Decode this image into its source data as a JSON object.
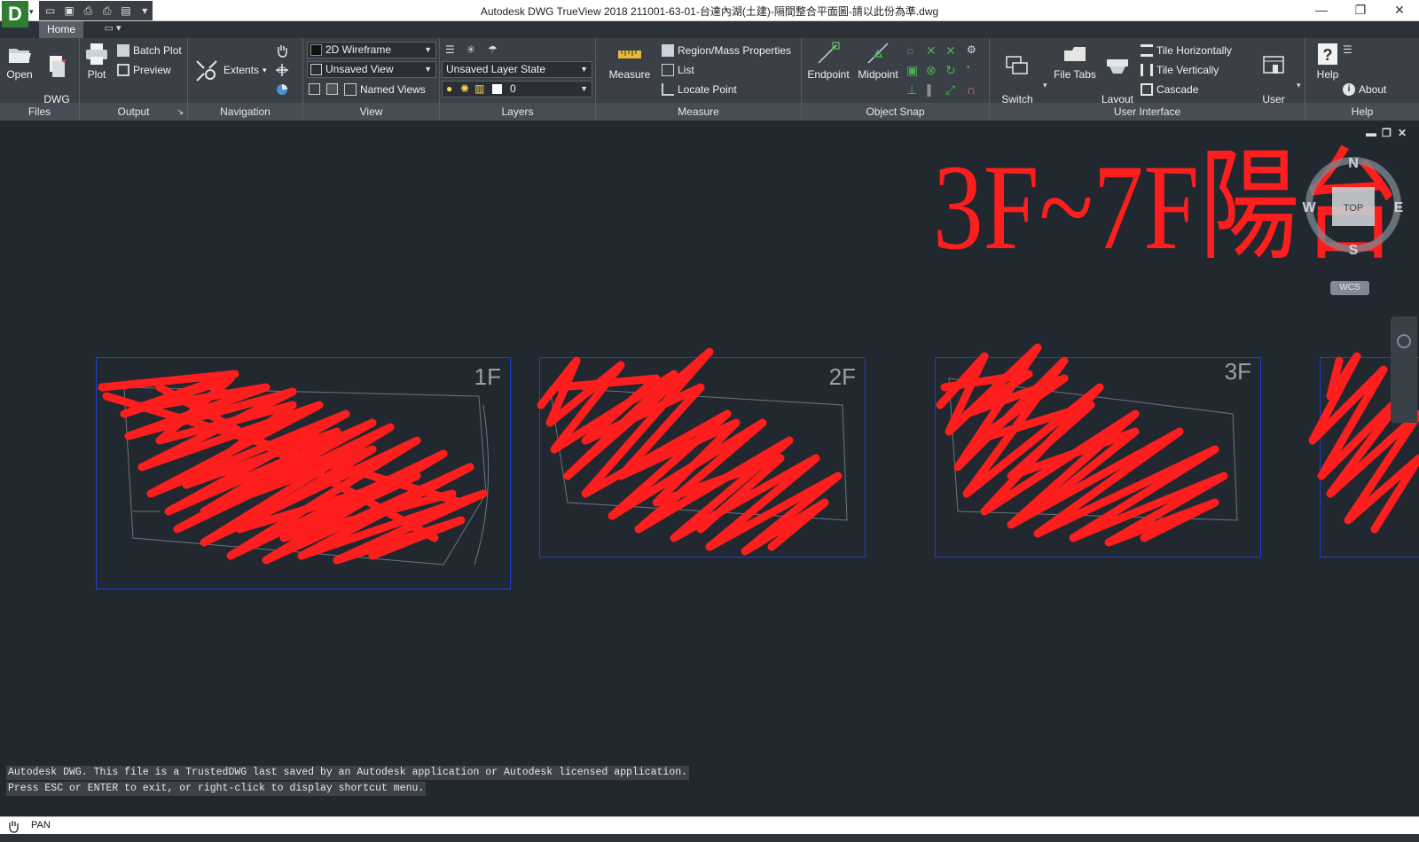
{
  "window": {
    "title": "Autodesk DWG TrueView 2018    211001-63-01-台達內湖(土建)-隔間整合平面圖-請以此份為準.dwg",
    "logo_letter": "D",
    "controls": [
      "—",
      "❐",
      "✕"
    ]
  },
  "quick_access": [
    "open-icon",
    "save-icon",
    "print-icon",
    "plot-icon",
    "publish-icon",
    "customize-icon"
  ],
  "ribbon": {
    "tabs": [
      {
        "label": "Home",
        "active": true
      }
    ],
    "extra_tab_icon": "workspace-icon",
    "panels": {
      "files": {
        "title": "Files",
        "open_label": "Open",
        "dwg_convert_label": "DWG\nConvert"
      },
      "output": {
        "title": "Output",
        "plot_label": "Plot",
        "batch_plot_label": "Batch Plot",
        "preview_label": "Preview"
      },
      "navigation": {
        "title": "Navigation",
        "extents_label": "Extents"
      },
      "view": {
        "title": "View",
        "visual_style": "2D Wireframe",
        "saved_view": "Unsaved View",
        "named_views_label": "Named Views"
      },
      "layers": {
        "title": "Layers",
        "layer_state": "Unsaved Layer State",
        "current_layer": "0"
      },
      "measure": {
        "title": "Measure",
        "measure_label": "Measure",
        "region_mass_label": "Region/Mass Properties",
        "list_label": "List",
        "locate_point_label": "Locate Point"
      },
      "object_snap": {
        "title": "Object Snap",
        "endpoint_label": "Endpoint",
        "midpoint_label": "Midpoint"
      },
      "user_interface": {
        "title": "User Interface",
        "switch_windows_label": "Switch\nWindows",
        "file_tabs_label": "File Tabs",
        "layout_tabs_label": "Layout\nTabs",
        "tile_horizontally_label": "Tile Horizontally",
        "tile_vertically_label": "Tile Vertically",
        "cascade_label": "Cascade",
        "user_interface_label": "User\nInterface"
      },
      "help": {
        "title": "Help",
        "help_label": "Help",
        "about_label": "About"
      }
    }
  },
  "drawing": {
    "annotation_text": "3F~7F陽台",
    "floors": [
      "1F",
      "2F",
      "3F"
    ],
    "viewcube": {
      "north": "N",
      "south": "S",
      "east": "E",
      "west": "W",
      "face": "TOP"
    },
    "wcs_label": "WCS",
    "colors": {
      "background": "#212830",
      "markup_red": "#ff1e1e",
      "frame_blue": "#1e40d8"
    }
  },
  "command_history": [
    "Autodesk DWG.  This file is a TrustedDWG last saved by an Autodesk application or Autodesk licensed application.",
    "Press ESC or ENTER to exit, or right-click to display shortcut menu."
  ],
  "status": {
    "mode": "PAN",
    "mode_icon": "pan-hand-icon"
  }
}
